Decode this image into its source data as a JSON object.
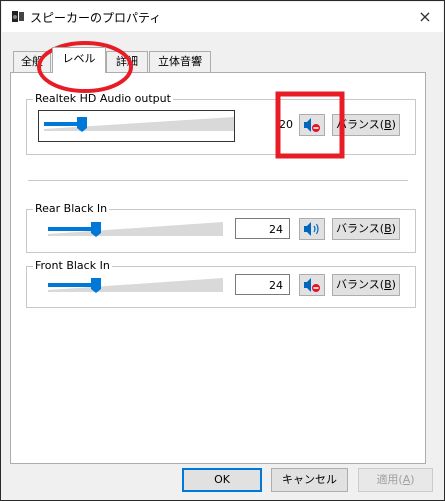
{
  "window": {
    "title": "スピーカーのプロパティ",
    "close_glyph": "×"
  },
  "tabs": [
    {
      "label": "全般",
      "active": false
    },
    {
      "label": "レベル",
      "active": true
    },
    {
      "label": "詳細",
      "active": false
    },
    {
      "label": "立体音響",
      "active": false
    }
  ],
  "main_output": {
    "label": "Realtek HD Audio output",
    "volume_value": "20",
    "volume_level_fraction": 0.2,
    "speaker_icon": "speaker-muted-icon",
    "balance_label": "バランス(",
    "balance_key": "B",
    "balance_close": ")"
  },
  "rear_black_in": {
    "label": "Rear Black In",
    "volume_value": "24",
    "volume_level_fraction": 0.24,
    "speaker_icon": "speaker-on-icon",
    "balance_label": "バランス(",
    "balance_key": "B",
    "balance_close": ")"
  },
  "front_black_in": {
    "label": "Front Black In",
    "volume_value": "24",
    "volume_level_fraction": 0.24,
    "speaker_icon": "speaker-muted-icon",
    "balance_label": "バランス(",
    "balance_key": "B",
    "balance_close": ")"
  },
  "footer": {
    "ok_label": "OK",
    "cancel_label": "キャンセル",
    "apply_label": "適用(",
    "apply_key": "A",
    "apply_close": ")"
  },
  "annotations": {
    "highlight_color": "#e81c24"
  },
  "colors": {
    "slider_thumb": "#0078d7",
    "muted_red": "#e81123"
  }
}
